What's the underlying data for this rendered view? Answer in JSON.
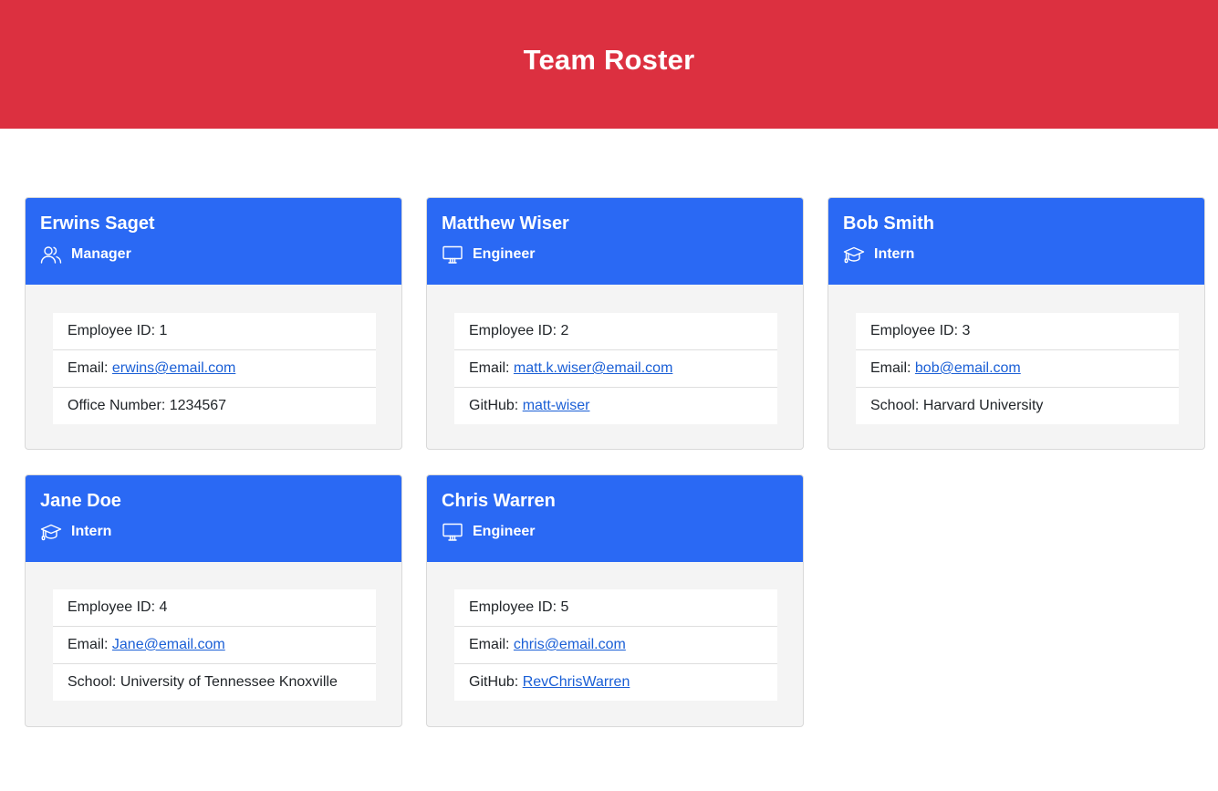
{
  "header": {
    "title": "Team Roster",
    "background": "#dc3040"
  },
  "colors": {
    "card_header": "#2a69f4",
    "link": "#1a5fd6"
  },
  "cards": [
    {
      "name": "Erwins Saget",
      "role": "Manager",
      "role_icon": "people-icon",
      "id_label": "Employee ID: 1",
      "email_label": "Email: ",
      "email": "erwins@email.com",
      "extra_label": "Office Number: 1234567",
      "extra_link": ""
    },
    {
      "name": "Matthew Wiser",
      "role": "Engineer",
      "role_icon": "monitor-icon",
      "id_label": "Employee ID: 2",
      "email_label": "Email: ",
      "email": "matt.k.wiser@email.com",
      "extra_label": "GitHub: ",
      "extra_link": "matt-wiser"
    },
    {
      "name": "Bob Smith",
      "role": "Intern",
      "role_icon": "graduation-cap-icon",
      "id_label": "Employee ID: 3",
      "email_label": "Email: ",
      "email": "bob@email.com",
      "extra_label": "School: Harvard University",
      "extra_link": ""
    },
    {
      "name": "Jane Doe",
      "role": "Intern",
      "role_icon": "graduation-cap-icon",
      "id_label": "Employee ID: 4",
      "email_label": "Email: ",
      "email": "Jane@email.com",
      "extra_label": "School: University of Tennessee Knoxville",
      "extra_link": ""
    },
    {
      "name": "Chris Warren",
      "role": "Engineer",
      "role_icon": "monitor-icon",
      "id_label": "Employee ID: 5",
      "email_label": "Email: ",
      "email": "chris@email.com",
      "extra_label": "GitHub: ",
      "extra_link": "RevChrisWarren"
    }
  ]
}
